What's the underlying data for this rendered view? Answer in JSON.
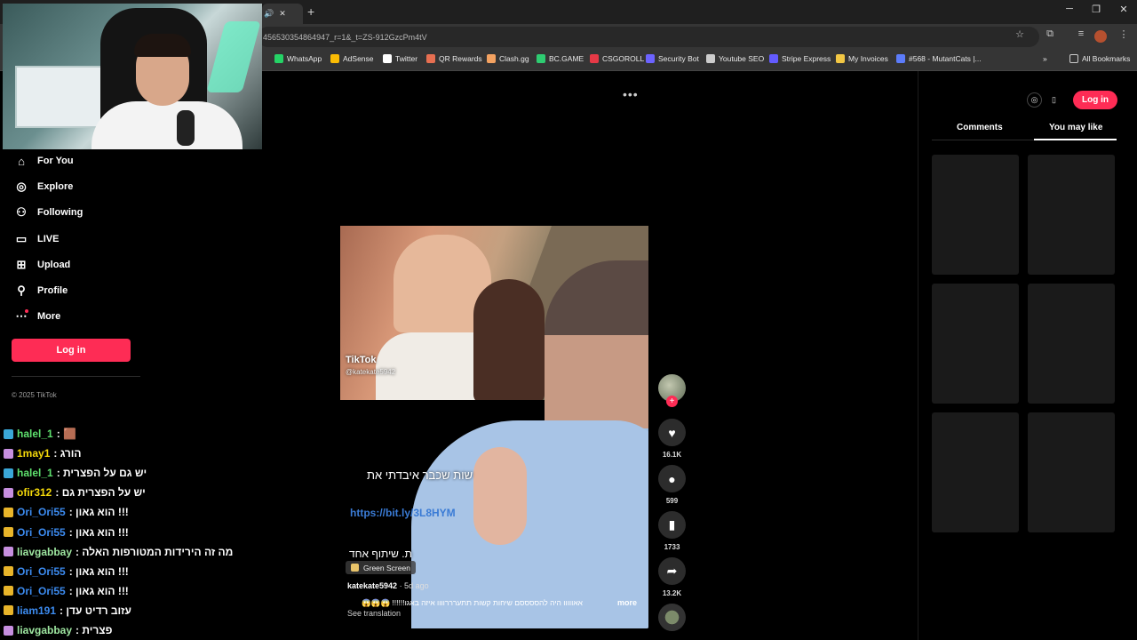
{
  "browser": {
    "tab_close_label": "✕",
    "new_tab_label": "+",
    "url": "456530354864947_r=1&_t=ZS-912GzcPm4tV",
    "bookmarks": [
      {
        "label": "WhatsApp",
        "color": "#25d366",
        "icon": "whatsapp-icon"
      },
      {
        "label": "AdSense",
        "color": "#fbbc04",
        "icon": "adsense-icon"
      },
      {
        "label": "Twitter",
        "color": "#ffffff",
        "icon": "x-icon"
      },
      {
        "label": "QR Rewards",
        "color": "#e76f51",
        "icon": "qr-rewards-icon"
      },
      {
        "label": "Clash.gg",
        "color": "#f4a261",
        "icon": "clash-icon"
      },
      {
        "label": "BC.GAME",
        "color": "#2ecc71",
        "icon": "bcgame-icon"
      },
      {
        "label": "CSGOROLL",
        "color": "#e63946",
        "icon": "csgoroll-icon"
      },
      {
        "label": "Security Bot",
        "color": "#6c63ff",
        "icon": "security-bot-icon"
      },
      {
        "label": "Youtube SEO",
        "color": "#cccccc",
        "icon": "youtube-seo-icon"
      },
      {
        "label": "Stripe Express",
        "color": "#635bff",
        "icon": "stripe-icon"
      },
      {
        "label": "My Invoices",
        "color": "#f2c744",
        "icon": "invoices-icon"
      },
      {
        "label": "#568 - MutantCats |...",
        "color": "#5c7cfa",
        "icon": "mutantcats-icon"
      }
    ],
    "all_bookmarks": "All Bookmarks"
  },
  "sidebar": {
    "nav": [
      {
        "label": "For You",
        "icon": "home-icon",
        "glyph": "⌂"
      },
      {
        "label": "Explore",
        "icon": "compass-icon",
        "glyph": "◎"
      },
      {
        "label": "Following",
        "icon": "following-icon",
        "glyph": "⚇"
      },
      {
        "label": "LIVE",
        "icon": "live-icon",
        "glyph": "▭"
      },
      {
        "label": "Upload",
        "icon": "upload-icon",
        "glyph": "⊞"
      },
      {
        "label": "Profile",
        "icon": "profile-icon",
        "glyph": "⚲"
      },
      {
        "label": "More",
        "icon": "more-icon",
        "glyph": "⋯"
      }
    ],
    "login": "Log in",
    "copyright": "© 2025 TikTok"
  },
  "chat": [
    {
      "user": "halel_1",
      "color": "#5ee06e",
      "msg": " : 🟫"
    },
    {
      "user": "1may1",
      "color": "#f5d90a",
      "msg": " : הורג"
    },
    {
      "user": "halel_1",
      "color": "#5ee06e",
      "msg": " : יש גם על הפצרית"
    },
    {
      "user": "ofir312",
      "color": "#f5d90a",
      "msg": " : יש על הפצרית גם"
    },
    {
      "user": "Ori_Ori55",
      "color": "#3c8bf0",
      "msg": " : הוא גאון !!!"
    },
    {
      "user": "Ori_Ori55",
      "color": "#3c8bf0",
      "msg": " : הוא גאון !!!"
    },
    {
      "user": "liavgabbay",
      "color": "#9ee6a0",
      "msg": " : מה זה הירידות המטורפות האלה"
    },
    {
      "user": "Ori_Ori55",
      "color": "#3c8bf0",
      "msg": " : הוא גאון !!!"
    },
    {
      "user": "Ori_Ori55",
      "color": "#3c8bf0",
      "msg": " : הוא גאון !!!"
    },
    {
      "user": "liam191",
      "color": "#3c8bf0",
      "msg": " : עזוב רדיט עדן"
    },
    {
      "user": "liavgabbay",
      "color": "#9ee6a0",
      "msg": " : פצרית"
    }
  ],
  "video": {
    "watermark": "TikTok",
    "watermark_user": "@katekate5942",
    "overlay_text": "שות שכבר איבדתי את",
    "overlay_link": "https://bit.ly/3L8HYM",
    "overlay_text2": "ת. שיתוף אחד",
    "effect": "Green Screen",
    "author": "katekate5942",
    "date": " · 5d ago",
    "caption": "אאווווו היה להססססם שיחות קשות תתערררוווו איזה באגו!!!!!! 😱😱😱",
    "more": "more",
    "see_translation": "See translation"
  },
  "actions": {
    "likes": "16.1K",
    "comments": "599",
    "saves": "1733",
    "shares": "13.2K"
  },
  "right_panel": {
    "login": "Log in",
    "tabs": [
      "Comments",
      "You may like"
    ],
    "active_tab": "You may like"
  }
}
